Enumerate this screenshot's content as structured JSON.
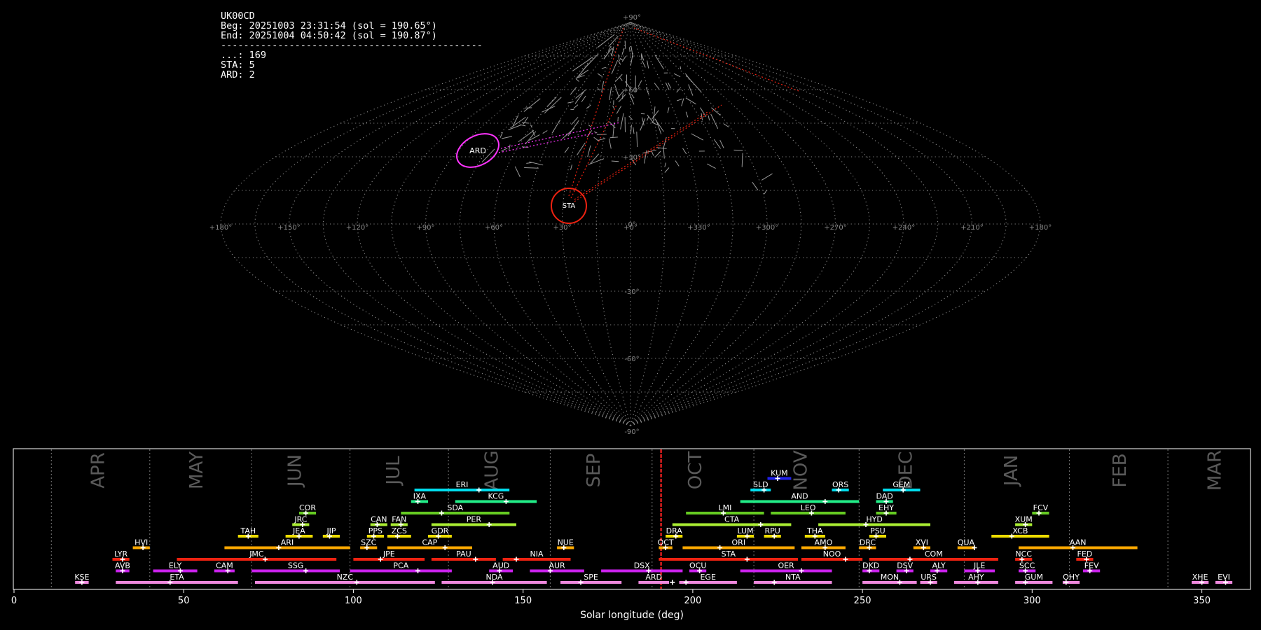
{
  "info": {
    "station": "UK00CD",
    "begin": "Beg: 20251003 23:31:54 (sol = 190.65°)",
    "end": "End: 20251004 04:50:42 (sol = 190.87°)",
    "separator": "----------------------------------------------",
    "counts": [
      {
        "label": "...",
        "value": "169"
      },
      {
        "label": "STA",
        "value": "5"
      },
      {
        "label": "ARD",
        "value": "2"
      }
    ]
  },
  "skymap": {
    "lat_ticks": [
      "+90°",
      "+60°",
      "+30°",
      "0°",
      "-30°",
      "-60°",
      "-90°"
    ],
    "lon_ticks": [
      "+180°",
      "+150°",
      "+120°",
      "+90°",
      "+60°",
      "+30°",
      "+0°",
      "+330°",
      "+300°",
      "+270°",
      "+240°",
      "+210°",
      "+180°"
    ],
    "radiants": [
      {
        "name": "ARD",
        "color": "#ff33ff"
      },
      {
        "name": "STA",
        "color": "#ee2211"
      }
    ]
  },
  "colors": {
    "background": "#000000",
    "now_line": "#ff2222",
    "grid": "#888888"
  },
  "chart_data": {
    "type": "gantt",
    "xlabel": "Solar longitude (deg)",
    "xlim": [
      0,
      360
    ],
    "xticks": [
      0,
      50,
      100,
      150,
      200,
      250,
      300,
      350
    ],
    "current_sol": 190.65,
    "months": [
      {
        "name": "APR",
        "label_sol": 25,
        "boundary_sol": 11
      },
      {
        "name": "MAY",
        "label_sol": 54,
        "boundary_sol": 40
      },
      {
        "name": "JUN",
        "label_sol": 83,
        "boundary_sol": 70
      },
      {
        "name": "JUL",
        "label_sol": 112,
        "boundary_sol": 99
      },
      {
        "name": "AUG",
        "label_sol": 141,
        "boundary_sol": 128
      },
      {
        "name": "SEP",
        "label_sol": 171,
        "boundary_sol": 158
      },
      {
        "name": "OCT",
        "label_sol": 201,
        "boundary_sol": 188
      },
      {
        "name": "NOV",
        "label_sol": 232,
        "boundary_sol": 218
      },
      {
        "name": "DEC",
        "label_sol": 263,
        "boundary_sol": 249
      },
      {
        "name": "JAN",
        "label_sol": 294,
        "boundary_sol": 280
      },
      {
        "name": "FEB",
        "label_sol": 326,
        "boundary_sol": 311
      },
      {
        "name": "MAR",
        "label_sol": 354,
        "boundary_sol": 340
      }
    ],
    "showers": [
      {
        "code": "KUM",
        "start": 222,
        "end": 229,
        "peak": 225,
        "row": 10,
        "color": "#2222ee"
      },
      {
        "code": "ERI",
        "start": 118,
        "end": 146,
        "peak": 137,
        "row": 9,
        "color": "#00ddee"
      },
      {
        "code": "SLD",
        "start": 217,
        "end": 223,
        "peak": 221,
        "row": 9,
        "color": "#00ddee"
      },
      {
        "code": "ORS",
        "start": 241,
        "end": 246,
        "peak": 243,
        "row": 9,
        "color": "#00ddee"
      },
      {
        "code": "GEM",
        "start": 256,
        "end": 267,
        "peak": 262,
        "row": 9,
        "color": "#00ddee"
      },
      {
        "code": "IXA",
        "start": 117,
        "end": 122,
        "peak": 119,
        "row": 8,
        "color": "#22ee88"
      },
      {
        "code": "KCG",
        "start": 130,
        "end": 154,
        "peak": 145,
        "row": 8,
        "color": "#22ee88"
      },
      {
        "code": "AND",
        "start": 214,
        "end": 249,
        "peak": 239,
        "row": 8,
        "color": "#22ee88"
      },
      {
        "code": "DAD",
        "start": 254,
        "end": 259,
        "peak": 257,
        "row": 8,
        "color": "#22ee88"
      },
      {
        "code": "COR",
        "start": 84,
        "end": 89,
        "peak": 86,
        "row": 7,
        "color": "#66cc22"
      },
      {
        "code": "SDA",
        "start": 114,
        "end": 146,
        "peak": 126,
        "row": 7,
        "color": "#66cc22"
      },
      {
        "code": "LMI",
        "start": 198,
        "end": 221,
        "peak": 209,
        "row": 7,
        "color": "#66cc22"
      },
      {
        "code": "LEO",
        "start": 223,
        "end": 245,
        "peak": 235,
        "row": 7,
        "color": "#66cc22"
      },
      {
        "code": "EHY",
        "start": 254,
        "end": 260,
        "peak": 257,
        "row": 7,
        "color": "#66cc22"
      },
      {
        "code": "FCV",
        "start": 300,
        "end": 305,
        "peak": 302,
        "row": 7,
        "color": "#66cc22"
      },
      {
        "code": "JRC",
        "start": 82,
        "end": 87,
        "peak": 85,
        "row": 6,
        "color": "#aaee33"
      },
      {
        "code": "CAN",
        "start": 105,
        "end": 110,
        "peak": 107,
        "row": 6,
        "color": "#aaee33"
      },
      {
        "code": "FAN",
        "start": 111,
        "end": 116,
        "peak": 114,
        "row": 6,
        "color": "#aaee33"
      },
      {
        "code": "PER",
        "start": 123,
        "end": 148,
        "peak": 140,
        "row": 6,
        "color": "#aaee33"
      },
      {
        "code": "CTA",
        "start": 194,
        "end": 229,
        "peak": 220,
        "row": 6,
        "color": "#aaee33"
      },
      {
        "code": "HYD",
        "start": 237,
        "end": 270,
        "peak": 251,
        "row": 6,
        "color": "#aaee33"
      },
      {
        "code": "XUM",
        "start": 295,
        "end": 300,
        "peak": 298,
        "row": 6,
        "color": "#aaee33"
      },
      {
        "code": "TAH",
        "start": 66,
        "end": 72,
        "peak": 69,
        "row": 5,
        "color": "#eedd00"
      },
      {
        "code": "JEA",
        "start": 80,
        "end": 88,
        "peak": 84,
        "row": 5,
        "color": "#eedd00"
      },
      {
        "code": "JIP",
        "start": 91,
        "end": 96,
        "peak": 93,
        "row": 5,
        "color": "#eedd00"
      },
      {
        "code": "PPS",
        "start": 104,
        "end": 109,
        "peak": 106,
        "row": 5,
        "color": "#eedd00"
      },
      {
        "code": "ZCS",
        "start": 110,
        "end": 117,
        "peak": 113,
        "row": 5,
        "color": "#eedd00"
      },
      {
        "code": "GDR",
        "start": 122,
        "end": 129,
        "peak": 125,
        "row": 5,
        "color": "#eedd00"
      },
      {
        "code": "DRA",
        "start": 192,
        "end": 197,
        "peak": 195,
        "row": 5,
        "color": "#eedd00"
      },
      {
        "code": "LUM",
        "start": 213,
        "end": 218,
        "peak": 216,
        "row": 5,
        "color": "#eedd00"
      },
      {
        "code": "RPU",
        "start": 221,
        "end": 226,
        "peak": 224,
        "row": 5,
        "color": "#eedd00"
      },
      {
        "code": "THA",
        "start": 233,
        "end": 239,
        "peak": 236,
        "row": 5,
        "color": "#eedd00"
      },
      {
        "code": "PSU",
        "start": 252,
        "end": 257,
        "peak": 254,
        "row": 5,
        "color": "#eedd00"
      },
      {
        "code": "XCB",
        "start": 288,
        "end": 305,
        "peak": 294,
        "row": 5,
        "color": "#eedd00"
      },
      {
        "code": "HVI",
        "start": 35,
        "end": 40,
        "peak": 38,
        "row": 4,
        "color": "#ffaa00"
      },
      {
        "code": "ARI",
        "start": 62,
        "end": 99,
        "peak": 78,
        "row": 4,
        "color": "#ffaa00"
      },
      {
        "code": "SZC",
        "start": 102,
        "end": 107,
        "peak": 104,
        "row": 4,
        "color": "#ffaa00"
      },
      {
        "code": "CAP",
        "start": 110,
        "end": 135,
        "peak": 127,
        "row": 4,
        "color": "#ffaa00"
      },
      {
        "code": "NUE",
        "start": 160,
        "end": 165,
        "peak": 162,
        "row": 4,
        "color": "#ffaa00"
      },
      {
        "code": "OCT",
        "start": 190,
        "end": 194,
        "peak": 192,
        "row": 4,
        "color": "#ffaa00"
      },
      {
        "code": "ORI",
        "start": 197,
        "end": 230,
        "peak": 208,
        "row": 4,
        "color": "#ffaa00"
      },
      {
        "code": "AMO",
        "start": 232,
        "end": 245,
        "peak": 239,
        "row": 4,
        "color": "#ffaa00"
      },
      {
        "code": "DRC",
        "start": 249,
        "end": 254,
        "peak": 252,
        "row": 4,
        "color": "#ffaa00"
      },
      {
        "code": "XVI",
        "start": 265,
        "end": 270,
        "peak": 268,
        "row": 4,
        "color": "#ffaa00"
      },
      {
        "code": "QUA",
        "start": 278,
        "end": 283,
        "peak": 283,
        "row": 4,
        "color": "#ffaa00"
      },
      {
        "code": "AAN",
        "start": 296,
        "end": 331,
        "peak": 312,
        "row": 4,
        "color": "#ffaa00"
      },
      {
        "code": "LYR",
        "start": 29,
        "end": 34,
        "peak": 32,
        "row": 3,
        "color": "#ee2211"
      },
      {
        "code": "JMC",
        "start": 48,
        "end": 95,
        "peak": 74,
        "row": 3,
        "color": "#ee2211"
      },
      {
        "code": "JPE",
        "start": 100,
        "end": 121,
        "peak": 108,
        "row": 3,
        "color": "#ee2211"
      },
      {
        "code": "PAU",
        "start": 123,
        "end": 142,
        "peak": 136,
        "row": 3,
        "color": "#ee2211"
      },
      {
        "code": "NIA",
        "start": 144,
        "end": 164,
        "peak": 148,
        "row": 3,
        "color": "#ee2211"
      },
      {
        "code": "STA",
        "start": 190,
        "end": 231,
        "peak": 216,
        "row": 3,
        "color": "#ee2211"
      },
      {
        "code": "NOO",
        "start": 232,
        "end": 250,
        "peak": 245,
        "row": 3,
        "color": "#ee2211"
      },
      {
        "code": "COM",
        "start": 252,
        "end": 290,
        "peak": 264,
        "row": 3,
        "color": "#ee2211"
      },
      {
        "code": "NCC",
        "start": 295,
        "end": 300,
        "peak": 297,
        "row": 3,
        "color": "#ee2211"
      },
      {
        "code": "FED",
        "start": 313,
        "end": 318,
        "peak": 316,
        "row": 3,
        "color": "#ee2211"
      },
      {
        "code": "AVB",
        "start": 30,
        "end": 34,
        "peak": 32,
        "row": 2,
        "color": "#cc22ee"
      },
      {
        "code": "ELY",
        "start": 41,
        "end": 54,
        "peak": 49,
        "row": 2,
        "color": "#cc22ee"
      },
      {
        "code": "CAM",
        "start": 59,
        "end": 65,
        "peak": 63,
        "row": 2,
        "color": "#cc22ee"
      },
      {
        "code": "SSG",
        "start": 70,
        "end": 96,
        "peak": 86,
        "row": 2,
        "color": "#cc22ee"
      },
      {
        "code": "PCA",
        "start": 99,
        "end": 129,
        "peak": 119,
        "row": 2,
        "color": "#cc22ee"
      },
      {
        "code": "AUD",
        "start": 140,
        "end": 147,
        "peak": 143,
        "row": 2,
        "color": "#cc22ee"
      },
      {
        "code": "AUR",
        "start": 152,
        "end": 168,
        "peak": 158,
        "row": 2,
        "color": "#cc22ee"
      },
      {
        "code": "DSX",
        "start": 173,
        "end": 197,
        "peak": 187,
        "row": 2,
        "color": "#cc22ee"
      },
      {
        "code": "OCU",
        "start": 199,
        "end": 204,
        "peak": 202,
        "row": 2,
        "color": "#cc22ee"
      },
      {
        "code": "OER",
        "start": 214,
        "end": 241,
        "peak": 232,
        "row": 2,
        "color": "#cc22ee"
      },
      {
        "code": "DKD",
        "start": 250,
        "end": 255,
        "peak": 252,
        "row": 2,
        "color": "#cc22ee"
      },
      {
        "code": "DSV",
        "start": 260,
        "end": 265,
        "peak": 263,
        "row": 2,
        "color": "#cc22ee"
      },
      {
        "code": "ALY",
        "start": 270,
        "end": 275,
        "peak": 272,
        "row": 2,
        "color": "#cc22ee"
      },
      {
        "code": "JLE",
        "start": 280,
        "end": 289,
        "peak": 284,
        "row": 2,
        "color": "#cc22ee"
      },
      {
        "code": "SCC",
        "start": 296,
        "end": 301,
        "peak": 298,
        "row": 2,
        "color": "#cc22ee"
      },
      {
        "code": "FEV",
        "start": 315,
        "end": 320,
        "peak": 317,
        "row": 2,
        "color": "#cc22ee"
      },
      {
        "code": "KSE",
        "start": 18,
        "end": 22,
        "peak": 20,
        "row": 1,
        "color": "#ee88dd"
      },
      {
        "code": "ETA",
        "start": 30,
        "end": 66,
        "peak": 46,
        "row": 1,
        "color": "#ee88dd"
      },
      {
        "code": "NZC",
        "start": 71,
        "end": 124,
        "peak": 101,
        "row": 1,
        "color": "#ee88dd"
      },
      {
        "code": "NDA",
        "start": 126,
        "end": 157,
        "peak": 141,
        "row": 1,
        "color": "#ee88dd"
      },
      {
        "code": "SPE",
        "start": 161,
        "end": 179,
        "peak": 167,
        "row": 1,
        "color": "#ee88dd"
      },
      {
        "code": "ARD",
        "start": 184,
        "end": 193,
        "peak": 194,
        "row": 1,
        "color": "#ee88dd"
      },
      {
        "code": "EGE",
        "start": 196,
        "end": 213,
        "peak": 198,
        "row": 1,
        "color": "#ee88dd"
      },
      {
        "code": "NTA",
        "start": 218,
        "end": 241,
        "peak": 224,
        "row": 1,
        "color": "#ee88dd"
      },
      {
        "code": "MON",
        "start": 250,
        "end": 266,
        "peak": 261,
        "row": 1,
        "color": "#ee88dd"
      },
      {
        "code": "URS",
        "start": 267,
        "end": 272,
        "peak": 270,
        "row": 1,
        "color": "#ee88dd"
      },
      {
        "code": "AHY",
        "start": 277,
        "end": 290,
        "peak": 284,
        "row": 1,
        "color": "#ee88dd"
      },
      {
        "code": "GUM",
        "start": 295,
        "end": 306,
        "peak": 298,
        "row": 1,
        "color": "#ee88dd"
      },
      {
        "code": "OHY",
        "start": 309,
        "end": 314,
        "peak": 310,
        "row": 1,
        "color": "#ee88dd"
      },
      {
        "code": "XHE",
        "start": 347,
        "end": 352,
        "peak": 350,
        "row": 1,
        "color": "#ee88dd"
      },
      {
        "code": "EVI",
        "start": 354,
        "end": 359,
        "peak": 357,
        "row": 1,
        "color": "#ee88dd"
      }
    ]
  }
}
